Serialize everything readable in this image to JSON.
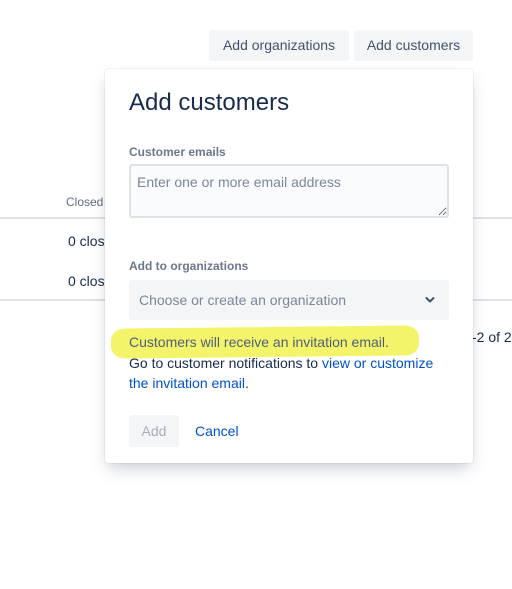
{
  "header": {
    "add_organizations_label": "Add organizations",
    "add_customers_label": "Add customers"
  },
  "background_table": {
    "column_header": "Closed",
    "rows": [
      "0 close",
      "0 close"
    ],
    "pagination": "-2 of 2"
  },
  "modal": {
    "title": "Add customers",
    "emails": {
      "label": "Customer emails",
      "placeholder": "Enter one or more email address",
      "value": ""
    },
    "organizations": {
      "label": "Add to organizations",
      "placeholder": "Choose or create an organization"
    },
    "notice": "Customers will receive an invitation email.",
    "help_prefix": "Go to customer notifications to ",
    "help_link": "view or customize the invitation email",
    "help_suffix": ".",
    "add_label": "Add",
    "cancel_label": "Cancel"
  },
  "colors": {
    "link": "#0052cc",
    "highlight": "#f3f35a",
    "button_bg": "#f4f5f7"
  },
  "icons": {
    "select_chevron": "chevron-down-icon"
  }
}
